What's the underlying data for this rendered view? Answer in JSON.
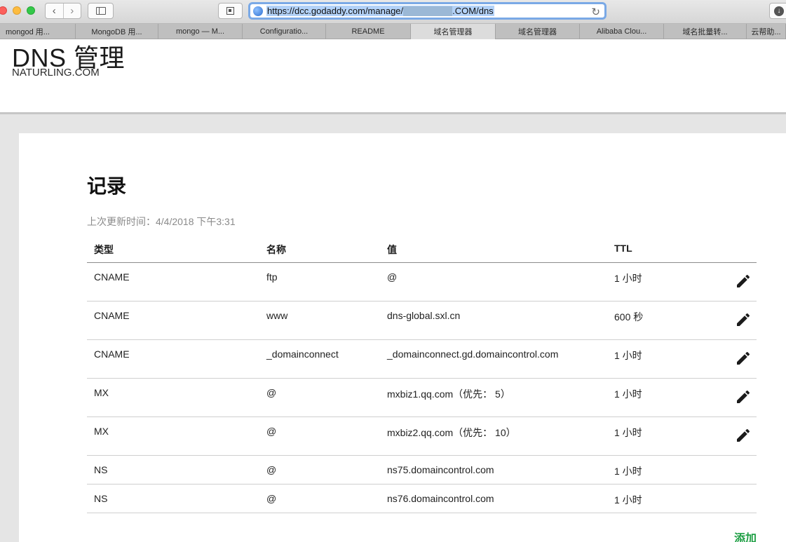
{
  "browser": {
    "url_prefix": "https://dcc.godaddy.com/manage/",
    "url_suffix": ".COM/dns",
    "tabs": [
      {
        "label": "mongod 用..."
      },
      {
        "label": "MongoDB 用..."
      },
      {
        "label": "mongo — M..."
      },
      {
        "label": "Configuratio..."
      },
      {
        "label": "README"
      },
      {
        "label": "域名管理器"
      },
      {
        "label": "域名管理器"
      },
      {
        "label": "Alibaba Clou..."
      },
      {
        "label": "域名批量转..."
      },
      {
        "label": "云帮助..."
      }
    ]
  },
  "header": {
    "title": "DNS 管理",
    "domain": "NATURLING.COM"
  },
  "records": {
    "title": "记录",
    "last_updated": "上次更新时间：4/4/2018 下午3:31",
    "columns": {
      "type": "类型",
      "name": "名称",
      "value": "值",
      "ttl": "TTL"
    },
    "rows": [
      {
        "type": "CNAME",
        "name": "ftp",
        "value": "@",
        "ttl": "1 小时",
        "editable": true
      },
      {
        "type": "CNAME",
        "name": "www",
        "value": "dns-global.sxl.cn",
        "ttl": "600 秒",
        "editable": true
      },
      {
        "type": "CNAME",
        "name": "_domainconnect",
        "value": "_domainconnect.gd.domaincontrol.com",
        "ttl": "1 小时",
        "editable": true
      },
      {
        "type": "MX",
        "name": "@",
        "value": "mxbiz1.qq.com（优先： 5）",
        "ttl": "1 小时",
        "editable": true
      },
      {
        "type": "MX",
        "name": "@",
        "value": "mxbiz2.qq.com（优先： 10）",
        "ttl": "1 小时",
        "editable": true
      },
      {
        "type": "NS",
        "name": "@",
        "value": "ns75.domaincontrol.com",
        "ttl": "1 小时",
        "editable": false
      },
      {
        "type": "NS",
        "name": "@",
        "value": "ns76.domaincontrol.com",
        "ttl": "1 小时",
        "editable": false
      }
    ],
    "add_label": "添加"
  },
  "colors": {
    "accent_green": "#1f9f45",
    "url_focus": "#7aa9e6"
  }
}
